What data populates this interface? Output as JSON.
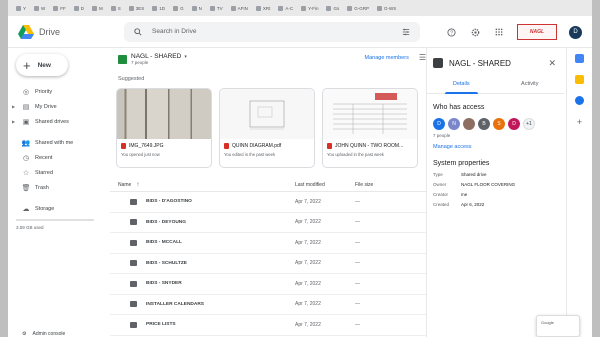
{
  "bookmarks": [
    "Y",
    "W",
    "FF",
    "D",
    "M",
    "S",
    "3ES",
    "1D",
    "G",
    "N",
    "TV",
    "AFIN",
    "XRt",
    "A-C",
    "Y-Fin",
    "Gs",
    "G-GRP",
    "G-WS"
  ],
  "header": {
    "app_name": "Drive",
    "search_placeholder": "Search in Drive",
    "brand_badge": "NAGL",
    "avatar_letter": "D"
  },
  "sidebar": {
    "new_label": "New",
    "items": [
      {
        "label": "Priority",
        "icon": "check-circle-icon"
      },
      {
        "label": "My Drive",
        "icon": "drive-icon"
      },
      {
        "label": "Shared drives",
        "icon": "shared-drive-icon"
      },
      {
        "label": "Shared with me",
        "icon": "people-icon"
      },
      {
        "label": "Recent",
        "icon": "clock-icon"
      },
      {
        "label": "Starred",
        "icon": "star-icon"
      },
      {
        "label": "Trash",
        "icon": "trash-icon"
      },
      {
        "label": "Storage",
        "icon": "cloud-icon"
      }
    ],
    "storage_used": "3.59 GB used",
    "admin_label": "Admin console"
  },
  "main": {
    "drive_title": "NAGL - SHARED",
    "people_count": "7 people",
    "manage_members": "Manage members",
    "suggested_label": "Suggested",
    "cards": [
      {
        "name": "IMG_7649.JPG",
        "sub": "You opened just now"
      },
      {
        "name": "QUINN DIAGRAM.pdf",
        "sub": "You edited in the past week"
      },
      {
        "name": "JOHN QUINN - TWO ROOM...",
        "sub": "You uploaded in the past week"
      }
    ],
    "columns": {
      "name": "Name",
      "modified": "Last modified",
      "size": "File size"
    },
    "rows": [
      {
        "name": "BIDS - D'AGOSTINO",
        "modified": "Apr 7, 2022",
        "size": "—"
      },
      {
        "name": "BIDS - DEYOUNG",
        "modified": "Apr 7, 2022",
        "size": "—"
      },
      {
        "name": "BIDS - MCCALL",
        "modified": "Apr 7, 2022",
        "size": "—"
      },
      {
        "name": "BIDS - SCHULTZE",
        "modified": "Apr 7, 2022",
        "size": "—"
      },
      {
        "name": "BIDS - SNYDER",
        "modified": "Apr 7, 2022",
        "size": "—"
      },
      {
        "name": "INSTALLER CALENDARS",
        "modified": "Apr 7, 2022",
        "size": "—"
      },
      {
        "name": "PRICE LISTS",
        "modified": "Apr 7, 2022",
        "size": "—"
      }
    ]
  },
  "panel": {
    "title": "NAGL - SHARED",
    "tab_details": "Details",
    "tab_activity": "Activity",
    "who_has_access": "Who has access",
    "avatars": [
      {
        "letter": "D",
        "color": "#1a73e8"
      },
      {
        "letter": "N",
        "color": "#7986cb"
      },
      {
        "letter": "",
        "color": "#8d6e63"
      },
      {
        "letter": "B",
        "color": "#5f6368"
      },
      {
        "letter": "S",
        "color": "#e8710a"
      },
      {
        "letter": "D",
        "color": "#c2185b"
      },
      {
        "letter": "+1",
        "color": "#f1f3f4"
      }
    ],
    "people_count": "7 people",
    "manage_access": "Manage access",
    "system_properties": "System properties",
    "props": [
      {
        "k": "Type",
        "v": "Shared drive"
      },
      {
        "k": "Owner",
        "v": "NAGL FLOOR COVERING"
      },
      {
        "k": "Creator",
        "v": "me"
      },
      {
        "k": "Created",
        "v": "Apr 6, 2022"
      }
    ]
  },
  "popup_text": "Google"
}
